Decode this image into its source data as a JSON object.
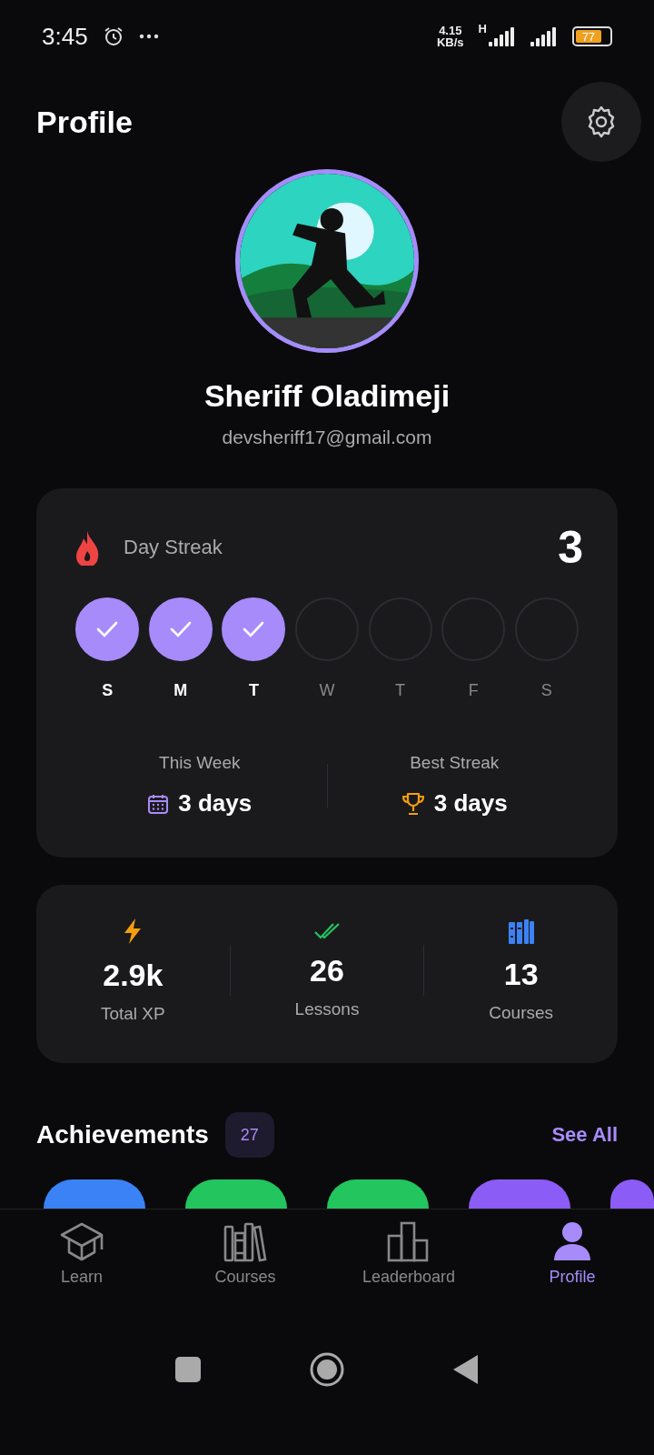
{
  "status_bar": {
    "time": "3:45",
    "net_speed": "4.15",
    "net_unit": "KB/s",
    "network_type": "H",
    "battery": "77"
  },
  "header": {
    "title": "Profile"
  },
  "profile": {
    "name": "Sheriff Oladimeji",
    "email": "devsheriff17@gmail.com"
  },
  "streak": {
    "title": "Day Streak",
    "count": "3",
    "days": [
      {
        "label": "S",
        "checked": true
      },
      {
        "label": "M",
        "checked": true
      },
      {
        "label": "T",
        "checked": true
      },
      {
        "label": "W",
        "checked": false
      },
      {
        "label": "T",
        "checked": false
      },
      {
        "label": "F",
        "checked": false
      },
      {
        "label": "S",
        "checked": false
      }
    ],
    "summary": [
      {
        "kind": "calendar",
        "label": "This Week",
        "value": "3 days"
      },
      {
        "kind": "trophy",
        "label": "Best Streak",
        "value": "3 days"
      }
    ]
  },
  "stats": [
    {
      "kind": "xp",
      "value": "2.9k",
      "label": "Total XP"
    },
    {
      "kind": "lessons",
      "value": "26",
      "label": "Lessons"
    },
    {
      "kind": "courses",
      "value": "13",
      "label": "Courses"
    }
  ],
  "achievements": {
    "title": "Achievements",
    "count": "27",
    "link": "See All",
    "items": [
      {
        "color": "#3b82f6"
      },
      {
        "color": "#22c55e"
      },
      {
        "color": "#22c55e"
      },
      {
        "color": "#8b5cf6"
      },
      {
        "color": "#8b5cf6"
      }
    ]
  },
  "bottom_nav": [
    {
      "kind": "learn",
      "label": "Learn",
      "selected": false
    },
    {
      "kind": "courses",
      "label": "Courses",
      "selected": false
    },
    {
      "kind": "leaderboard",
      "label": "Leaderboard",
      "selected": false
    },
    {
      "kind": "profile",
      "label": "Profile",
      "selected": true
    }
  ]
}
